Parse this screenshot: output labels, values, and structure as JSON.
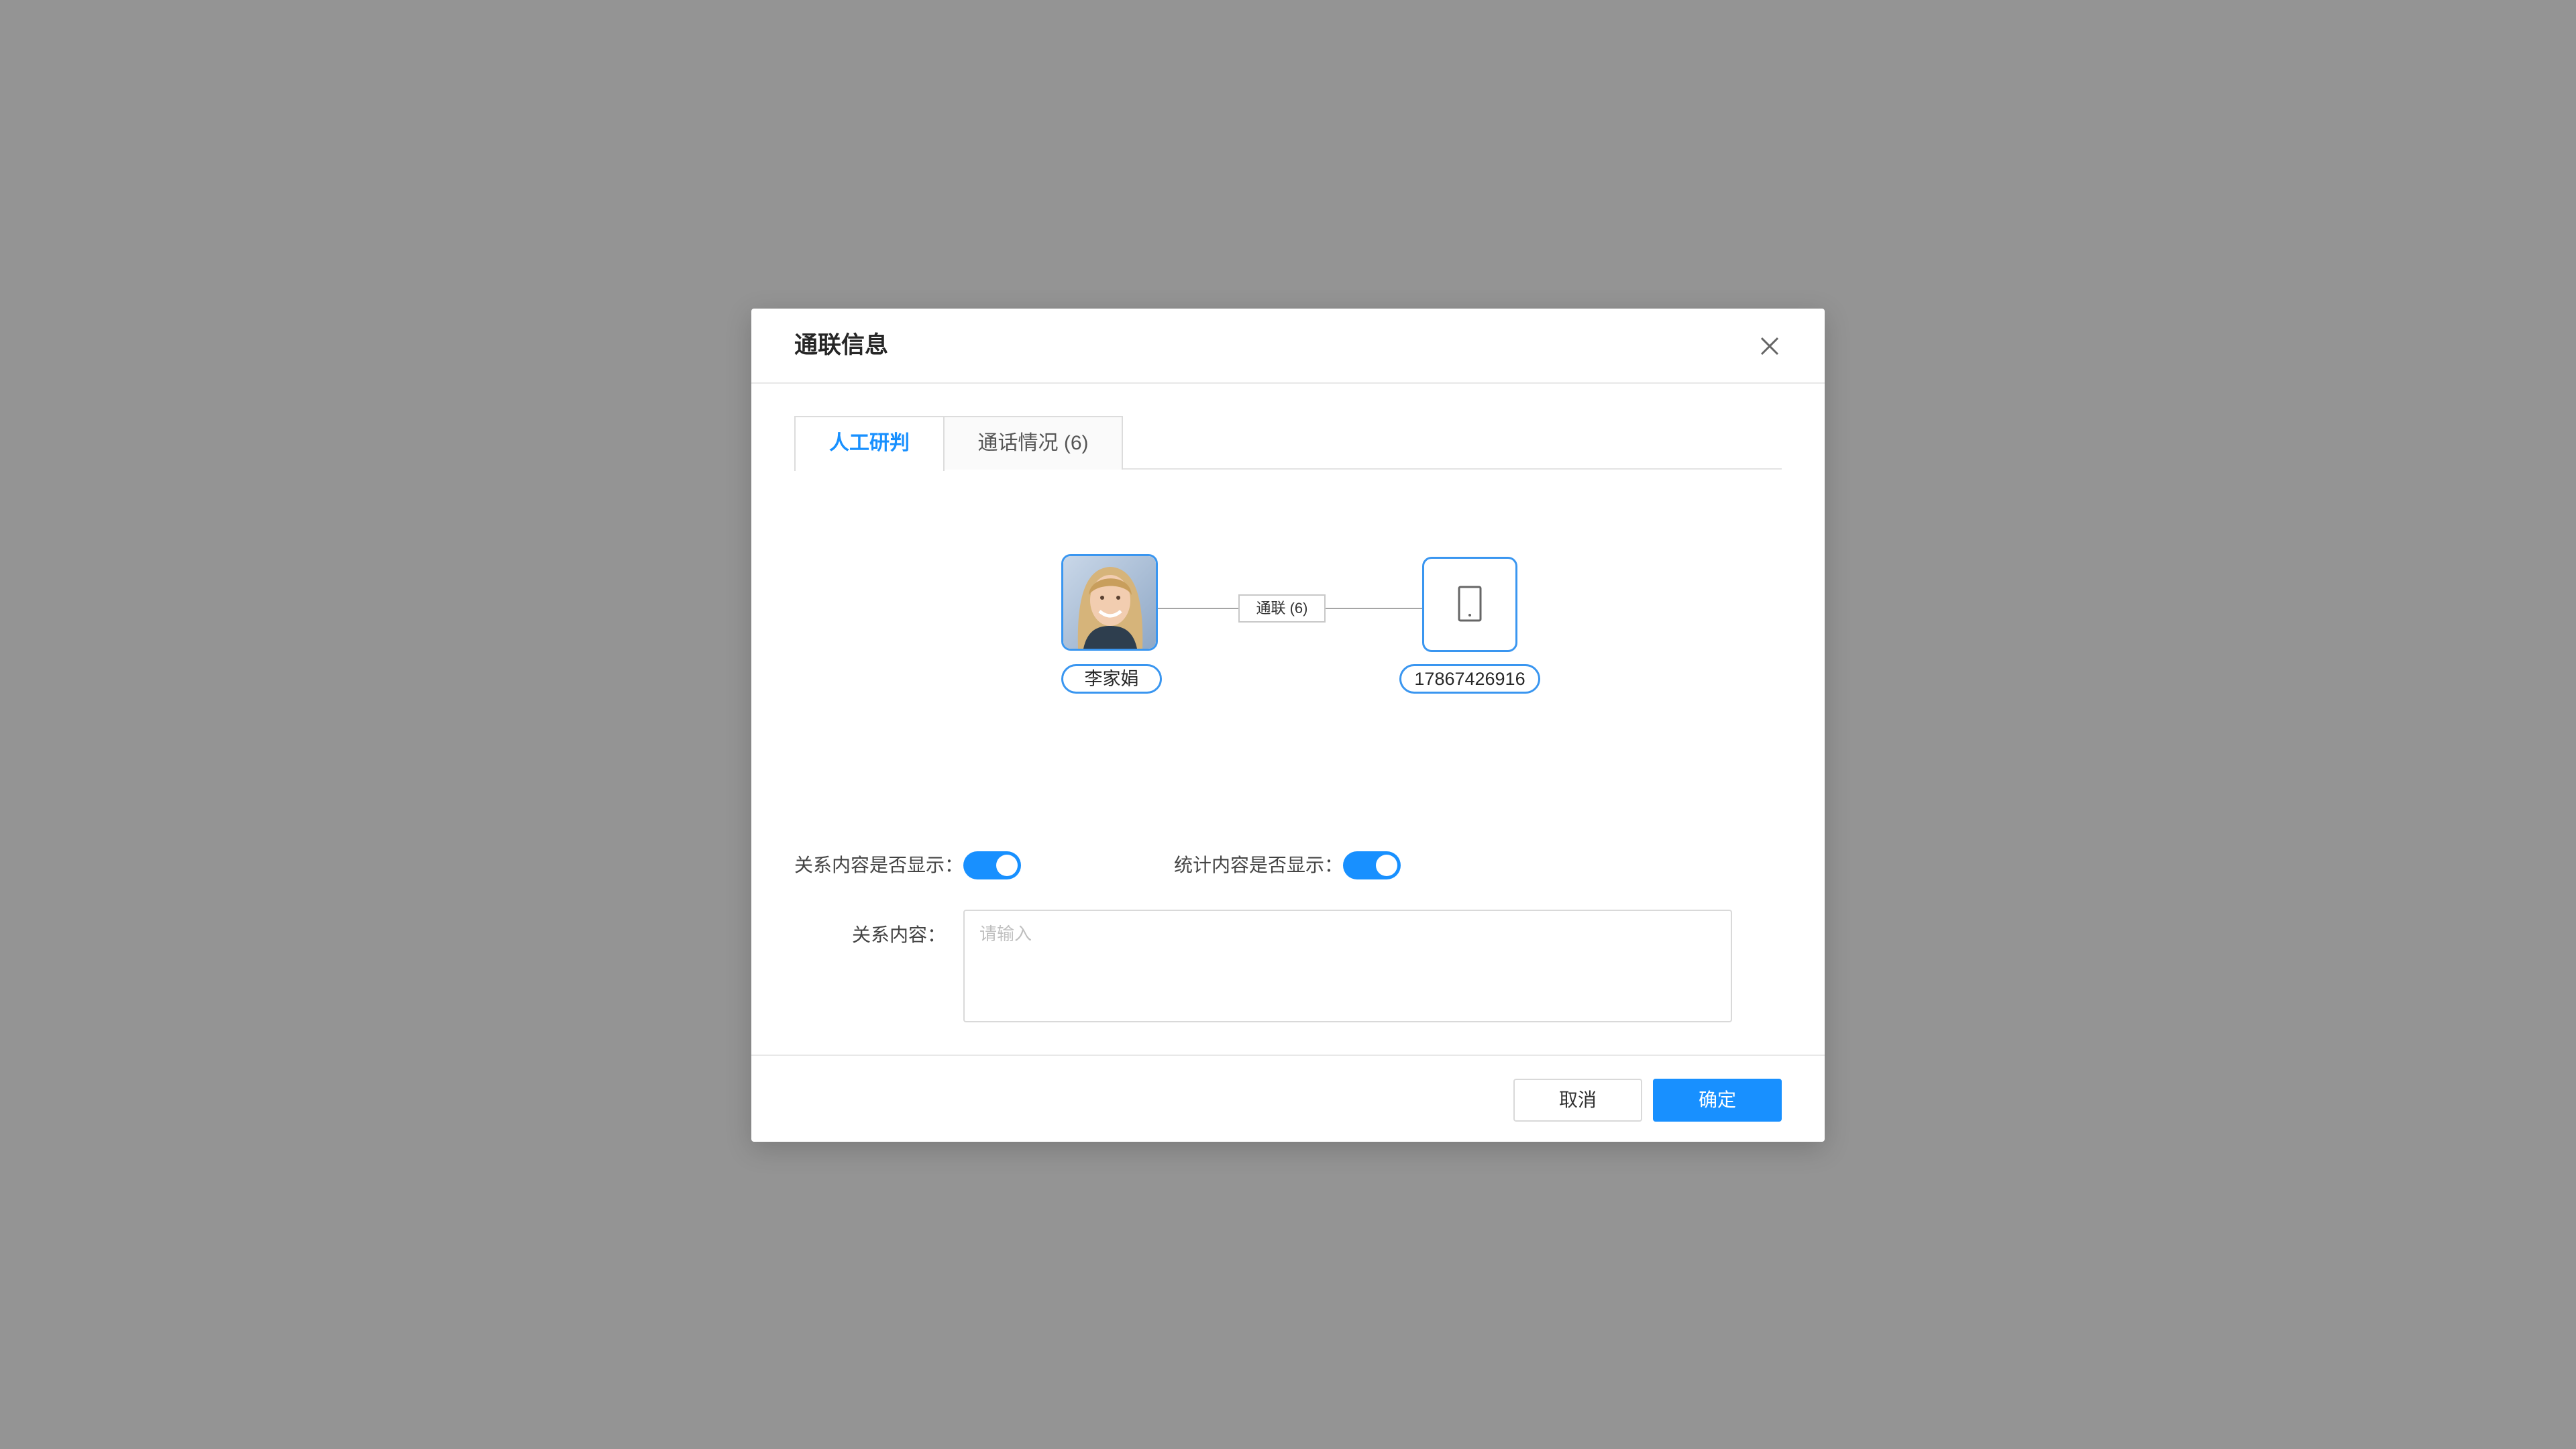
{
  "modal": {
    "title": "通联信息",
    "close_icon": "close-icon"
  },
  "tabs": [
    {
      "label": "人工研判",
      "active": true
    },
    {
      "label": "通话情况 (6)",
      "active": false
    }
  ],
  "graph": {
    "person": {
      "name": "李家娟",
      "icon": "person-avatar-photo"
    },
    "edge": {
      "label": "通联 (6)"
    },
    "phone": {
      "number": "17867426916",
      "icon": "mobile-phone-icon"
    }
  },
  "toggles": [
    {
      "label": "关系内容是否显示：",
      "on": true
    },
    {
      "label": "统计内容是否显示：",
      "on": true
    }
  ],
  "relation_field": {
    "label": "关系内容：",
    "placeholder": "请输入",
    "value": ""
  },
  "footer": {
    "cancel_label": "取消",
    "ok_label": "确定"
  },
  "colors": {
    "accent": "#1890ff",
    "overlay": "#949494",
    "node_border": "#3a96f0"
  }
}
